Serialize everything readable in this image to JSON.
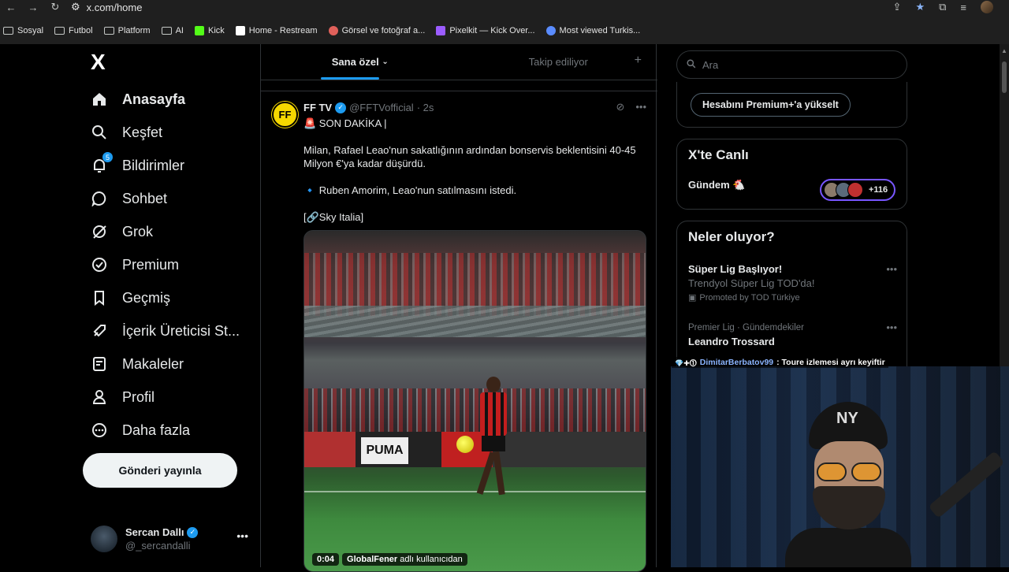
{
  "browser": {
    "url": "x.com/home",
    "bookmarks": [
      {
        "label": "Sosyal",
        "type": "folder"
      },
      {
        "label": "Futbol",
        "type": "folder"
      },
      {
        "label": "Platform",
        "type": "folder"
      },
      {
        "label": "AI",
        "type": "folder"
      },
      {
        "label": "Kick",
        "type": "site",
        "color": "#53fc18"
      },
      {
        "label": "Home - Restream",
        "type": "site",
        "color": "#ffffff"
      },
      {
        "label": "Görsel ve fotoğraf a...",
        "type": "site",
        "color": "#e0605a"
      },
      {
        "label": "Pixelkit — Kick Over...",
        "type": "site",
        "color": "#9b5cff"
      },
      {
        "label": "Most viewed Turkis...",
        "type": "site",
        "color": "#5a8cff"
      }
    ]
  },
  "sidebar": {
    "logo": "X",
    "items": [
      {
        "label": "Anasayfa",
        "icon": "home-icon"
      },
      {
        "label": "Keşfet",
        "icon": "search-icon"
      },
      {
        "label": "Bildirimler",
        "icon": "bell-icon",
        "badge": "5"
      },
      {
        "label": "Sohbet",
        "icon": "chat-icon"
      },
      {
        "label": "Grok",
        "icon": "grok-icon"
      },
      {
        "label": "Premium",
        "icon": "premium-icon"
      },
      {
        "label": "Geçmiş",
        "icon": "bookmark-icon"
      },
      {
        "label": "İçerik Üreticisi St...",
        "icon": "rocket-icon"
      },
      {
        "label": "Makaleler",
        "icon": "article-icon"
      },
      {
        "label": "Profil",
        "icon": "person-icon"
      },
      {
        "label": "Daha fazla",
        "icon": "more-circle-icon"
      }
    ],
    "post_button": "Gönderi yayınla",
    "profile": {
      "name": "Sercan Dallı",
      "handle": "@_sercandalli"
    }
  },
  "main": {
    "tabs": [
      {
        "label": "Sana özel"
      },
      {
        "label": "Takip ediliyor"
      }
    ],
    "tweet": {
      "avatar_text": "FF",
      "name": "FF TV",
      "handle": "@FFTVofficial",
      "time": "· 2s",
      "lines": [
        "🚨 SON DAKİKA |",
        "Milan, Rafael Leao'nun sakatlığının ardından bonservis beklentisini 40-45 Milyon €'ya kadar düşürdü.",
        "🔹 Ruben Amorim, Leao'nun satılmasını istedi.",
        "[🔗Sky Italia]"
      ],
      "video_time": "0:04",
      "video_user": "GlobalFener",
      "video_suffix": "adlı kullanıcıdan",
      "ad_text": "PUMA"
    }
  },
  "right": {
    "search_placeholder": "Ara",
    "premium_button": "Hesabını Premium+'a yükselt",
    "live": {
      "title": "X'te Canlı",
      "subtitle": "Gündem 🐔",
      "count": "+116"
    },
    "trends_title": "Neler oluyor?",
    "trends": [
      {
        "title": "Süper Lig Başlıyor!",
        "desc": "Trendyol Süper Lig TOD'da!",
        "promo": "Promoted by TOD Türkiye"
      },
      {
        "category": "Premier Lig · Gündemdekiler",
        "title": "Leandro Trossard"
      }
    ]
  },
  "overlay": {
    "chat_user": "DimitarBerbatov99",
    "chat_text": ": Toure izlemesi ayrı keyiftir",
    "cap_logo": "NY"
  },
  "colors": {
    "accent": "#1d9bf0",
    "live_border": "#7856ff"
  }
}
